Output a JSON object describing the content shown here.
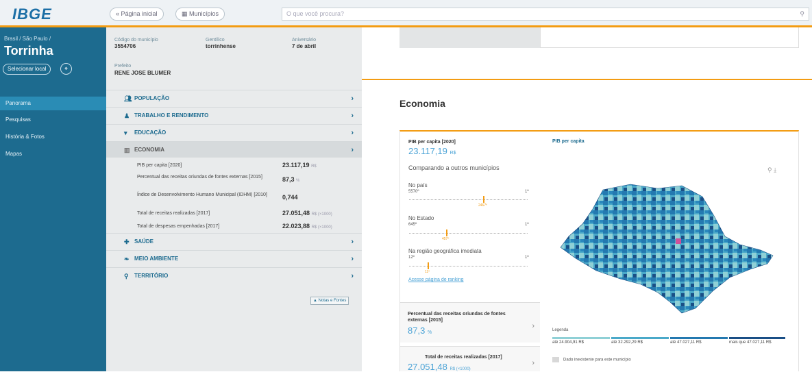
{
  "header": {
    "logo": "IBGE",
    "btn_home": "Página inicial",
    "btn_muni": "Municípios",
    "search_placeholder": "O que você procura?"
  },
  "sidebar": {
    "crumb": "Brasil / São Paulo /",
    "city": "Torrinha",
    "select_btn": "Selecionar local",
    "items": [
      {
        "label": "Panorama"
      },
      {
        "label": "Pesquisas"
      },
      {
        "label": "História & Fotos"
      },
      {
        "label": "Mapas"
      }
    ]
  },
  "meta": {
    "code_label": "Código do município",
    "code_value": "3554706",
    "gentile_label": "Gentílico",
    "gentile_value": "torrinhense",
    "anniv_label": "Aniversário",
    "anniv_value": "7 de abril",
    "mayor_label": "Prefeito",
    "mayor_value": "RENE JOSE BLUMER"
  },
  "categories": [
    {
      "label": "POPULAÇÃO"
    },
    {
      "label": "TRABALHO E RENDIMENTO"
    },
    {
      "label": "EDUCAÇÃO"
    },
    {
      "label": "ECONOMIA"
    },
    {
      "label": "SAÚDE"
    },
    {
      "label": "MEIO AMBIENTE"
    },
    {
      "label": "TERRITÓRIO"
    }
  ],
  "economy_indicators": [
    {
      "label": "PIB per capita [2020]",
      "value": "23.117,19",
      "unit": "R$"
    },
    {
      "label": "Percentual das receitas oriundas de fontes externas [2015]",
      "value": "87,3",
      "unit": "%"
    },
    {
      "label": "Índice de Desenvolvimento Humano Municipal (IDHM) [2010]",
      "value": "0,744",
      "unit": ""
    },
    {
      "label": "Total de receitas realizadas [2017]",
      "value": "27.051,48",
      "unit": "R$ (×1000)"
    },
    {
      "label": "Total de despesas empenhadas [2017]",
      "value": "22.023,88",
      "unit": "R$ (×1000)"
    }
  ],
  "notes_btn": "Notas e Fontes",
  "main": {
    "section_title": "Economia",
    "pib_title": "PIB per capita [2020]",
    "pib_value": "23.117,19",
    "pib_unit": "R$",
    "compare_title": "Comparando a outros municípios",
    "rank_country_label": "No país",
    "rank_country_low": "5570º",
    "rank_country_high": "1º",
    "rank_state_label": "No Estado",
    "rank_state_low": "645º",
    "rank_state_high": "1º",
    "rank_region_label": "Na região geográfica imediata",
    "rank_region_low": "12º",
    "rank_region_high": "1º",
    "marker_country": "2467º",
    "marker_state": "457º",
    "marker_region": "11º",
    "link": "Acesse página de ranking",
    "card2_title": "Percentual das receitas oriundas de fontes externas [2015]",
    "card2_value": "87,3",
    "card2_unit": "%",
    "card3_title": "Total de receitas realizadas [2017]",
    "card3_value": "27.051,48",
    "card3_unit": "R$ (×1000)"
  },
  "map": {
    "title": "PIB per capita",
    "legend_title": "Legenda",
    "legend": [
      {
        "label": "até 24.904,91 R$",
        "color": "#8fd0d6"
      },
      {
        "label": "até 32.292,29 R$",
        "color": "#4aa9c9"
      },
      {
        "label": "até 47.027,11 R$",
        "color": "#2479b0"
      },
      {
        "label": "mais que 47.027,11 R$",
        "color": "#1a4f86"
      }
    ],
    "no_data": "Dado inexistente para este município",
    "highlight_color": "#d0509a"
  },
  "colors": {
    "accent": "#f39c12",
    "nav": "#1d6b8f",
    "link": "#4ba3d6"
  }
}
